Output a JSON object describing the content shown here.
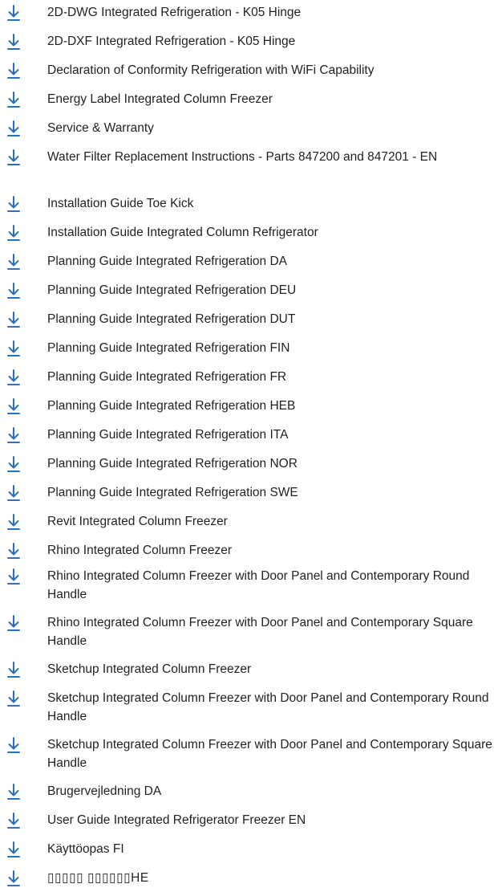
{
  "accent_color": "#2a6fb8",
  "icon": "download-arrow-icon",
  "downloads": [
    {
      "label": "2D-DWG Integrated Refrigeration - K05 Hinge"
    },
    {
      "label": "2D-DXF Integrated Refrigeration - K05 Hinge"
    },
    {
      "label": "Declaration of Conformity Refrigeration with WiFi Capability"
    },
    {
      "label": "Energy Label Integrated Column Freezer"
    },
    {
      "label": "Service & Warranty"
    },
    {
      "label": "Water Filter Replacement Instructions - Parts 847200 and 847201 - EN"
    },
    {
      "label": "Installation Guide Toe Kick"
    },
    {
      "label": "Installation Guide Integrated Column Refrigerator"
    },
    {
      "label": "Planning Guide Integrated Refrigeration DA"
    },
    {
      "label": "Planning Guide Integrated Refrigeration DEU"
    },
    {
      "label": "Planning Guide Integrated Refrigeration DUT"
    },
    {
      "label": "Planning Guide Integrated Refrigeration FIN"
    },
    {
      "label": "Planning Guide Integrated Refrigeration FR"
    },
    {
      "label": "Planning Guide Integrated Refrigeration HEB"
    },
    {
      "label": "Planning Guide Integrated Refrigeration ITA"
    },
    {
      "label": "Planning Guide Integrated Refrigeration NOR"
    },
    {
      "label": "Planning Guide Integrated Refrigeration SWE"
    },
    {
      "label": "Revit Integrated Column Freezer"
    },
    {
      "label": "Rhino Integrated Column Freezer"
    },
    {
      "label": "Rhino Integrated Column Freezer with Door Panel and Contemporary Round Handle"
    },
    {
      "label": "Rhino Integrated Column Freezer with Door Panel and Contemporary Square Handle"
    },
    {
      "label": "Sketchup Integrated Column Freezer"
    },
    {
      "label": "Sketchup Integrated Column Freezer with Door Panel and Contemporary Round Handle"
    },
    {
      "label": "Sketchup Integrated Column Freezer with Door Panel and Contemporary Square Handle"
    },
    {
      "label": "Brugervejledning DA"
    },
    {
      "label": "User Guide Integrated Refrigerator Freezer EN"
    },
    {
      "label": "Käyttöopas FI"
    },
    {
      "label": "▯▯▯▯▯ ▯▯▯▯▯▯HE"
    }
  ]
}
